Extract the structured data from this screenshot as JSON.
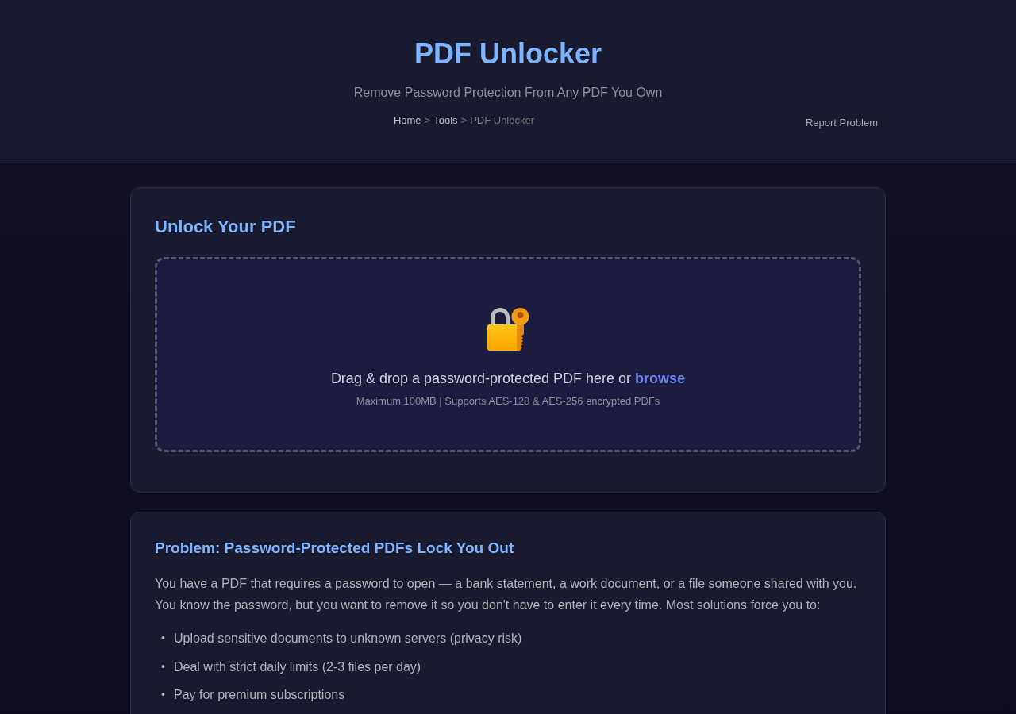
{
  "header": {
    "title": "PDF Unlocker",
    "subtitle": "Remove Password Protection From Any PDF You Own",
    "breadcrumb": [
      {
        "label": "Home",
        "kind": "link"
      },
      {
        "label": ">",
        "kind": "separator"
      },
      {
        "label": "Tools",
        "kind": "link"
      },
      {
        "label": ">",
        "kind": "separator"
      },
      {
        "label": "PDF Unlocker",
        "kind": "current"
      }
    ],
    "report_button": "Report Problem"
  },
  "upload_card": {
    "heading": "Unlock Your PDF",
    "dropzone": {
      "prompt": "Drag & drop a password-protected PDF here or",
      "browse_link": "browse",
      "hint": "Maximum 100MB | Supports AES-128 & AES-256 encrypted PDFs"
    }
  },
  "problem_card": {
    "heading": "Problem: Password-Protected PDFs Lock You Out",
    "paragraph": "You have a PDF that requires a password to open — a bank statement, a work document, or a file someone shared with you. You know the password, but you want to remove it so you don't have to enter it every time. Most solutions force you to:",
    "bullets": [
      {
        "marker": "•",
        "text": "Upload sensitive documents to unknown servers (privacy risk)"
      },
      {
        "marker": "•",
        "text": "Deal with strict daily limits (2-3 files per day)"
      },
      {
        "marker": "•",
        "text": "Pay for premium subscriptions"
      }
    ]
  }
}
